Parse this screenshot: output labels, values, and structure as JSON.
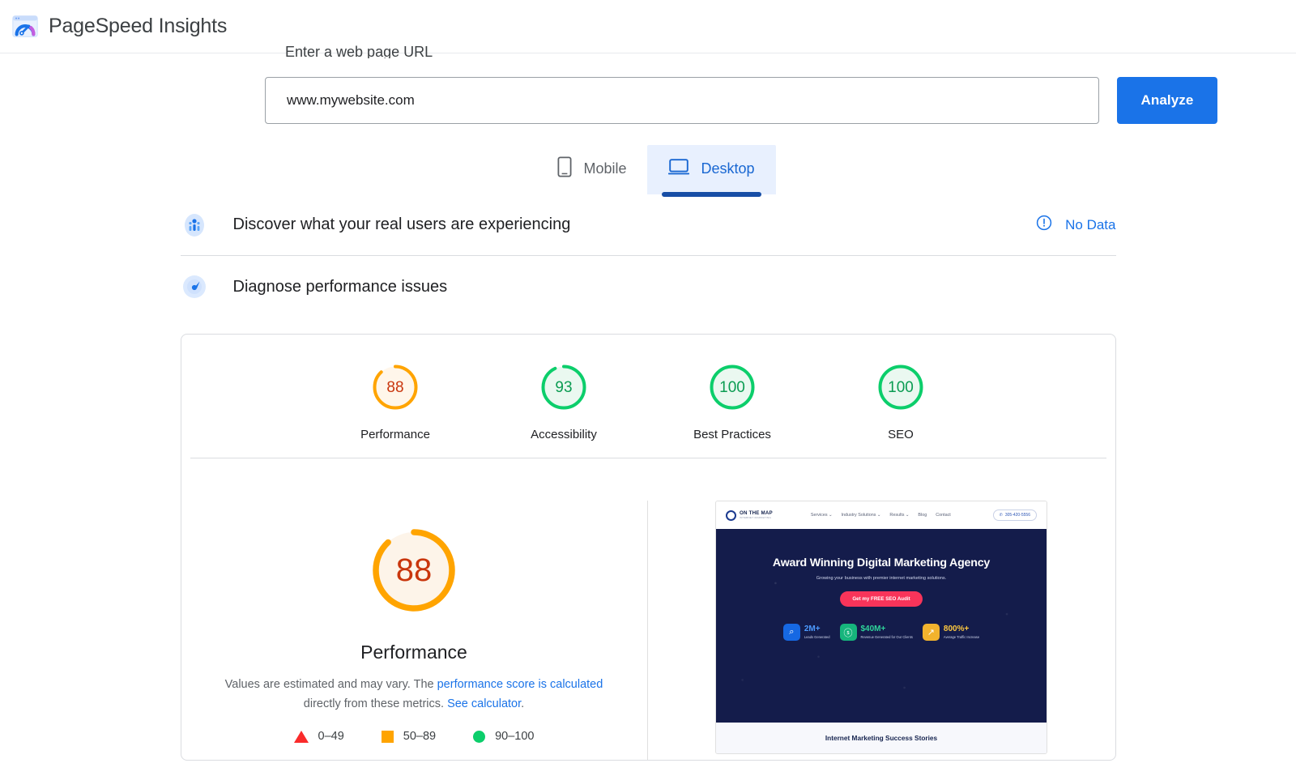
{
  "header": {
    "brand": "PageSpeed Insights",
    "logo_icon": "pagespeed-gauge-logo"
  },
  "search": {
    "clipped_heading": "Enter a web page URL",
    "url_value": "www.mywebsite.com",
    "url_placeholder": "Enter a web page URL",
    "analyze_label": "Analyze"
  },
  "device_tabs": [
    {
      "label": "Mobile",
      "icon": "mobile-phone-icon",
      "active": false
    },
    {
      "label": "Desktop",
      "icon": "desktop-monitor-icon",
      "active": true
    }
  ],
  "sections": {
    "field_data": {
      "icon": "real-users-icon",
      "title": "Discover what your real users are experiencing",
      "status_icon": "info-circle-icon",
      "status_label": "No Data"
    },
    "lab_data": {
      "icon": "diagnose-gauge-icon",
      "title": "Diagnose performance issues"
    }
  },
  "scores": {
    "summary": [
      {
        "label": "Performance",
        "value": "88",
        "percent": 88,
        "color": "#ffa400",
        "text_color": "#c9360d",
        "fill": "#fff6ea"
      },
      {
        "label": "Accessibility",
        "value": "93",
        "percent": 93,
        "color": "#0cce6b",
        "text_color": "#0b9c52",
        "fill": "#eaf8f0"
      },
      {
        "label": "Best Practices",
        "value": "100",
        "percent": 100,
        "color": "#0cce6b",
        "text_color": "#0b9c52",
        "fill": "#eaf8f0"
      },
      {
        "label": "SEO",
        "value": "100",
        "percent": 100,
        "color": "#0cce6b",
        "text_color": "#0b9c52",
        "fill": "#eaf8f0"
      }
    ],
    "detail": {
      "value": "88",
      "percent": 88,
      "title": "Performance",
      "desc_part1": "Values are estimated and may vary. The ",
      "desc_link1": "performance score is calculated",
      "desc_part2": " directly from these metrics. ",
      "desc_link2": "See calculator",
      "desc_part3": ".",
      "legend": [
        {
          "shape": "triangle",
          "range": "0–49",
          "color": "#fa2b2b"
        },
        {
          "shape": "square",
          "range": "50–89",
          "color": "#ffa400"
        },
        {
          "shape": "circle",
          "range": "90–100",
          "color": "#0cce6b"
        }
      ]
    }
  },
  "thumbnail": {
    "logo_main": "ON THE MAP",
    "logo_sub": "INTERNET MARKETING",
    "nav": [
      "Services",
      "Industry Solutions",
      "Results",
      "Blog",
      "Contact"
    ],
    "phone": "305-420-5556",
    "headline": "Award Winning Digital Marketing Agency",
    "subhead": "Growing your business with premier internet marketing solutions.",
    "cta": "Get my FREE SEO Audit",
    "stats": [
      {
        "value": "2M+",
        "caption": "Leads Generated",
        "value_color": "#4d9bff",
        "box_color": "#1668e3",
        "icon": "analytics-icon"
      },
      {
        "value": "$40M+",
        "caption": "Revenue Generated for Our Clients",
        "value_color": "#2fd49a",
        "box_color": "#16b57c",
        "icon": "revenue-icon"
      },
      {
        "value": "800%+",
        "caption": "Average Traffic Increase",
        "value_color": "#ffc93f",
        "box_color": "#f2b32e",
        "icon": "traffic-growth-icon"
      }
    ],
    "footer": "Internet Marketing Success Stories"
  }
}
